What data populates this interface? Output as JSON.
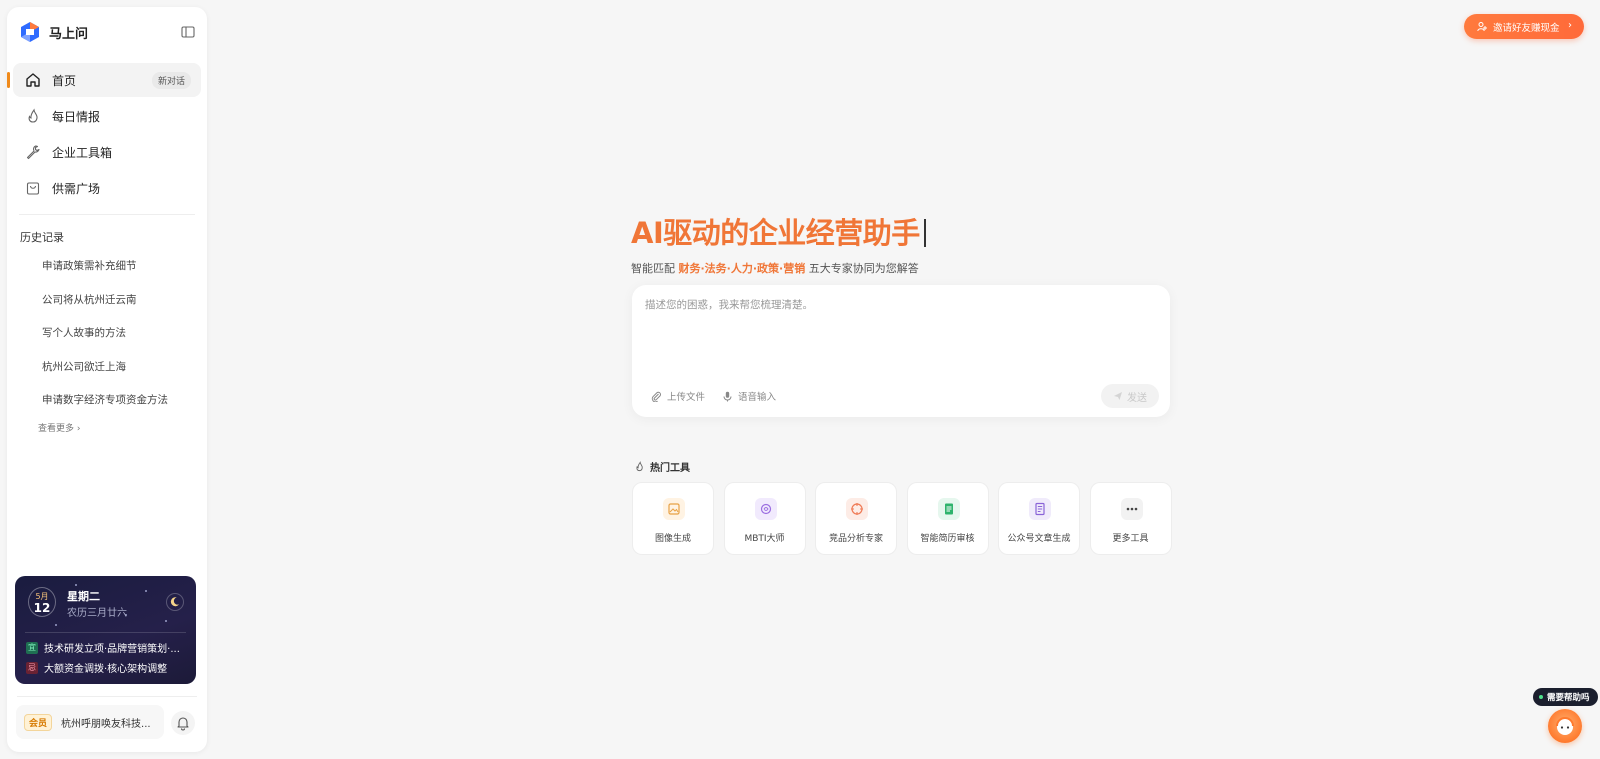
{
  "brand": {
    "name": "马上问"
  },
  "nav": {
    "items": [
      {
        "label": "首页",
        "badge": "新对话"
      },
      {
        "label": "每日情报"
      },
      {
        "label": "企业工具箱"
      },
      {
        "label": "供需广场"
      }
    ]
  },
  "history": {
    "title": "历史记录",
    "items": [
      "申请政策需补充细节",
      "公司将从杭州迁云南",
      "写个人故事的方法",
      "杭州公司欲迁上海",
      "申请数字经济专项资金方法"
    ],
    "see_more": "查看更多"
  },
  "calendar": {
    "month": "5月",
    "day": "12",
    "weekday": "星期二",
    "lunar": "农历三月廿六",
    "yi_tag": "宜",
    "yi_text": "技术研发立项·品牌营销策划·...",
    "ji_tag": "忌",
    "ji_text": "大额资金调拨·核心架构调整"
  },
  "member": {
    "badge": "会员",
    "company": "杭州呼朋唤友科技..."
  },
  "invite": {
    "label": "邀请好友赚现金"
  },
  "hero": {
    "title": "AI驱动的企业经营助手",
    "sub_prefix": "智能匹配 ",
    "sub_highlight": "财务·法务·人力·政策·营销",
    "sub_suffix": " 五大专家协同为您解答"
  },
  "chat": {
    "placeholder": "描述您的困惑，我来帮您梳理清楚。",
    "upload_label": "上传文件",
    "voice_label": "语音输入",
    "send_label": "发送"
  },
  "tools": {
    "title": "热门工具",
    "items": [
      {
        "label": "图像生成",
        "color": "#fff3e3"
      },
      {
        "label": "MBTI大师",
        "color": "#f1eafd"
      },
      {
        "label": "竞品分析专家",
        "color": "#fdece6"
      },
      {
        "label": "智能简历审核",
        "color": "#e6f7ee"
      },
      {
        "label": "公众号文章生成",
        "color": "#f0ebfb"
      },
      {
        "label": "更多工具",
        "color": "#f2f2f2"
      }
    ]
  },
  "help": {
    "label": "需要帮助吗"
  },
  "colors": {
    "accent": "#f07637",
    "active_marker": "#f08a1a",
    "invite_bg": "#ff7a3d"
  }
}
